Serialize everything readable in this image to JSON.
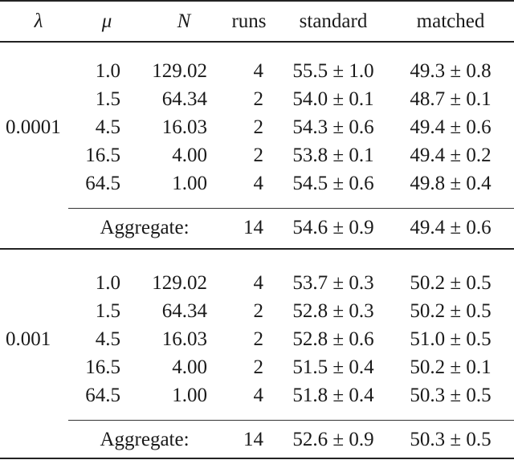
{
  "table": {
    "headers": {
      "lambda": "λ",
      "mu": "μ",
      "N": "N",
      "runs": "runs",
      "standard": "standard",
      "matched": "matched"
    },
    "groups": [
      {
        "lambda": "0.0001",
        "rows": [
          {
            "mu": "1.0",
            "N": "129.02",
            "runs": "4",
            "standard": "55.5 ± 1.0",
            "matched": "49.3 ± 0.8"
          },
          {
            "mu": "1.5",
            "N": "64.34",
            "runs": "2",
            "standard": "54.0 ± 0.1",
            "matched": "48.7 ± 0.1"
          },
          {
            "mu": "4.5",
            "N": "16.03",
            "runs": "2",
            "standard": "54.3 ± 0.6",
            "matched": "49.4 ± 0.6"
          },
          {
            "mu": "16.5",
            "N": "4.00",
            "runs": "2",
            "standard": "53.8 ± 0.1",
            "matched": "49.4 ± 0.2"
          },
          {
            "mu": "64.5",
            "N": "1.00",
            "runs": "4",
            "standard": "54.5 ± 0.6",
            "matched": "49.8 ± 0.4"
          }
        ],
        "aggregate": {
          "label": "Aggregate:",
          "runs": "14",
          "standard": "54.6 ± 0.9",
          "matched": "49.4 ± 0.6"
        }
      },
      {
        "lambda": "0.001",
        "rows": [
          {
            "mu": "1.0",
            "N": "129.02",
            "runs": "4",
            "standard": "53.7 ± 0.3",
            "matched": "50.2 ± 0.5"
          },
          {
            "mu": "1.5",
            "N": "64.34",
            "runs": "2",
            "standard": "52.8 ± 0.3",
            "matched": "50.2 ± 0.5"
          },
          {
            "mu": "4.5",
            "N": "16.03",
            "runs": "2",
            "standard": "52.8 ± 0.6",
            "matched": "51.0 ± 0.5"
          },
          {
            "mu": "16.5",
            "N": "4.00",
            "runs": "2",
            "standard": "51.5 ± 0.4",
            "matched": "50.2 ± 0.1"
          },
          {
            "mu": "64.5",
            "N": "1.00",
            "runs": "4",
            "standard": "51.8 ± 0.4",
            "matched": "50.3 ± 0.5"
          }
        ],
        "aggregate": {
          "label": "Aggregate:",
          "runs": "14",
          "standard": "52.6 ± 0.9",
          "matched": "50.3 ± 0.5"
        }
      }
    ]
  }
}
